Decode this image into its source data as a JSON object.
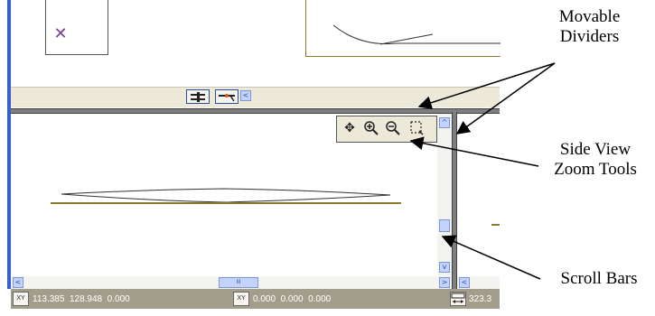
{
  "top_pane": {
    "tool_glyph": "✕"
  },
  "toolbar": {
    "icons": [
      "align-icon",
      "snap-icon"
    ],
    "scroll_left": "<"
  },
  "zoom_tools": {
    "icons": [
      "pan-icon",
      "zoom-in-icon",
      "zoom-out-icon",
      "zoom-box-icon"
    ]
  },
  "scrollbars": {
    "up": "^",
    "down": "v",
    "left": "<",
    "right": ">",
    "thumb_grip": "III"
  },
  "status_bar": {
    "coords_1": "113.385  128.948  0.000",
    "coords_2": "0.000  0.000  0.000",
    "coords_3": "323.3",
    "icon_1_label": "XY",
    "icon_2_label": "XY"
  },
  "callouts": {
    "movable_dividers": "Movable\nDividers",
    "side_view_zoom": "Side View\nZoom Tools",
    "scroll_bars": "Scroll Bars"
  },
  "colors": {
    "olive_line": "#8a7a2a",
    "divider": "#7f7f7f",
    "status_bg": "#a39e8c",
    "scroll_btn": "#c3d3fd",
    "left_edge": "#3a5fcd"
  }
}
